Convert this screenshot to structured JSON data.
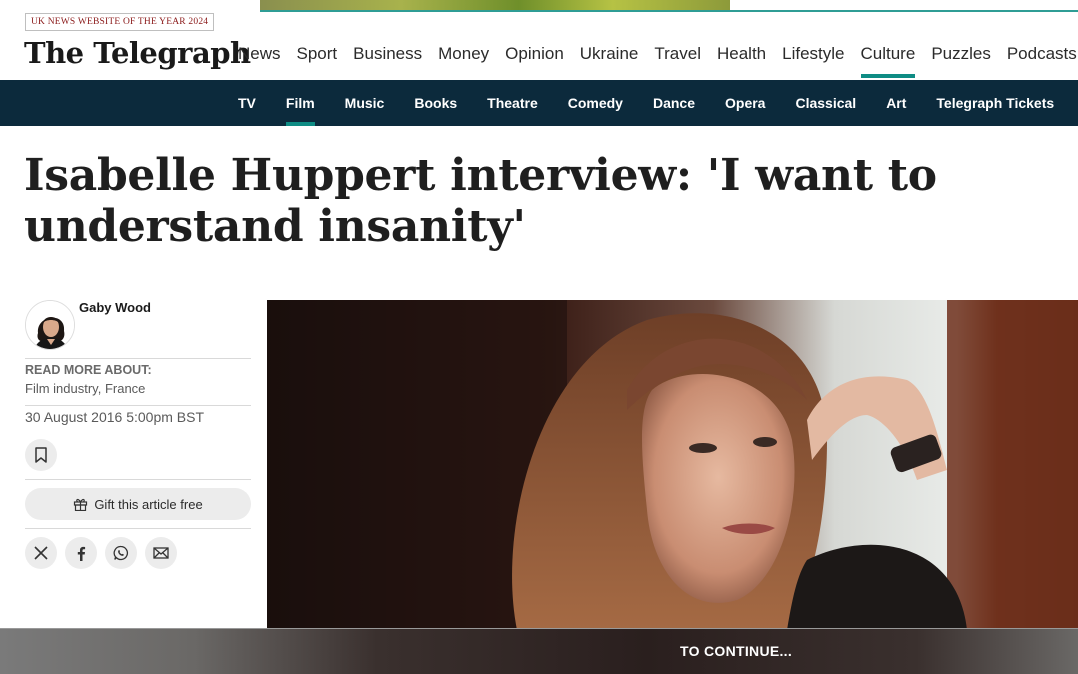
{
  "award_badge": "UK NEWS WEBSITE OF THE YEAR 2024",
  "logo_text": "The Telegraph",
  "primary_nav": [
    {
      "label": "News",
      "active": false
    },
    {
      "label": "Sport",
      "active": false
    },
    {
      "label": "Business",
      "active": false
    },
    {
      "label": "Money",
      "active": false
    },
    {
      "label": "Opinion",
      "active": false
    },
    {
      "label": "Ukraine",
      "active": false
    },
    {
      "label": "Travel",
      "active": false
    },
    {
      "label": "Health",
      "active": false
    },
    {
      "label": "Lifestyle",
      "active": false
    },
    {
      "label": "Culture",
      "active": true
    },
    {
      "label": "Puzzles",
      "active": false
    },
    {
      "label": "Podcasts",
      "active": false
    }
  ],
  "secondary_nav": [
    {
      "label": "TV",
      "active": false
    },
    {
      "label": "Film",
      "active": true
    },
    {
      "label": "Music",
      "active": false
    },
    {
      "label": "Books",
      "active": false
    },
    {
      "label": "Theatre",
      "active": false
    },
    {
      "label": "Comedy",
      "active": false
    },
    {
      "label": "Dance",
      "active": false
    },
    {
      "label": "Opera",
      "active": false
    },
    {
      "label": "Classical",
      "active": false
    },
    {
      "label": "Art",
      "active": false
    },
    {
      "label": "Telegraph Tickets",
      "active": false
    }
  ],
  "article": {
    "headline": "Isabelle Huppert interview: 'I want to understand insanity'",
    "author": "Gaby Wood",
    "read_more_label": "READ MORE ABOUT:",
    "topics": [
      "Film industry",
      "France"
    ],
    "date": "30 August 2016 5:00pm BST",
    "gift_label": "Gift this article free"
  },
  "share_icons": [
    "x-icon",
    "facebook-icon",
    "whatsapp-icon",
    "email-icon"
  ],
  "overlay": {
    "continue_label": "TO CONTINUE..."
  },
  "colors": {
    "accent": "#0e8c84",
    "nav_bg": "#0c2a3c",
    "award_text": "#8b1a1a"
  }
}
